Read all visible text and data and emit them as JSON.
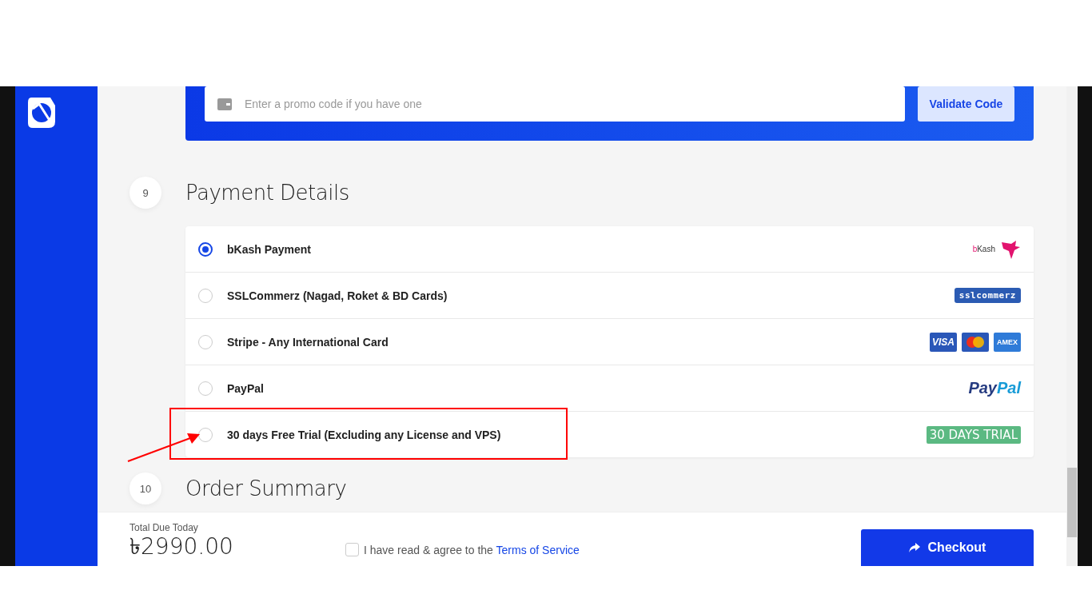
{
  "promo": {
    "placeholder": "Enter a promo code if you have one",
    "button": "Validate Code"
  },
  "payment_step": {
    "number": "9",
    "title": "Payment Details"
  },
  "methods": [
    {
      "label": "bKash Payment",
      "selected": true,
      "highlighted": false,
      "logo": {
        "kind": "bird",
        "text": "bKash"
      }
    },
    {
      "label": "SSLCommerz (Nagad, Roket & BD Cards)",
      "selected": false,
      "highlighted": false,
      "logo": {
        "kind": "banner",
        "text": "sslcommerz"
      }
    },
    {
      "label": "Stripe - Any International Card",
      "selected": false,
      "highlighted": false,
      "logo": {
        "kind": "cards",
        "items": [
          {
            "kind": "text",
            "text": "VISA",
            "color": "#2a57b8"
          },
          {
            "kind": "circles",
            "color": "#2a57b8"
          },
          {
            "kind": "text",
            "text": "AMEX",
            "color": "#2f7bd8"
          }
        ]
      }
    },
    {
      "label": "PayPal",
      "selected": false,
      "highlighted": false,
      "logo": {
        "kind": "split",
        "parts": [
          "Pay",
          "Pal"
        ]
      }
    },
    {
      "label": "30 days Free Trial (Excluding any License and VPS)",
      "selected": false,
      "highlighted": true,
      "logo": {
        "kind": "badge",
        "text": "30 DAYS TRIAL"
      }
    }
  ],
  "summary_step": {
    "number": "10",
    "title": "Order Summary"
  },
  "footer": {
    "total_label": "Total Due Today",
    "total": "৳2990.00",
    "agree": {
      "checked": false,
      "text": "I have read & agree to the ",
      "link": "Terms of Service"
    },
    "checkout": "Checkout"
  }
}
